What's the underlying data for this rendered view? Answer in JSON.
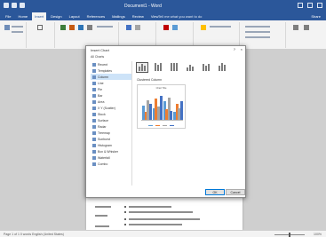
{
  "window": {
    "title": "Document1 - Word"
  },
  "tabs": [
    {
      "label": "File"
    },
    {
      "label": "Home"
    },
    {
      "label": "Insert"
    },
    {
      "label": "Design"
    },
    {
      "label": "Layout"
    },
    {
      "label": "References"
    },
    {
      "label": "Mailings"
    },
    {
      "label": "Review"
    },
    {
      "label": "View"
    }
  ],
  "tell_me": "Tell me what you want to do",
  "share": "Share",
  "dialog": {
    "title": "Insert Chart",
    "help": "?",
    "close": "×",
    "all_charts_label": "All Charts",
    "types": [
      {
        "label": "Recent"
      },
      {
        "label": "Templates"
      },
      {
        "label": "Column"
      },
      {
        "label": "Line"
      },
      {
        "label": "Pie"
      },
      {
        "label": "Bar"
      },
      {
        "label": "Area"
      },
      {
        "label": "X Y (Scatter)"
      },
      {
        "label": "Stock"
      },
      {
        "label": "Surface"
      },
      {
        "label": "Radar"
      },
      {
        "label": "Treemap"
      },
      {
        "label": "Sunburst"
      },
      {
        "label": "Histogram"
      },
      {
        "label": "Box & Whisker"
      },
      {
        "label": "Waterfall"
      },
      {
        "label": "Combo"
      }
    ],
    "selected_type": "Column",
    "preview_label": "Clustered Column",
    "preview_title": "Chart Title",
    "ok": "OK",
    "cancel": "Cancel"
  },
  "preview_colors": [
    "#5b9bd5",
    "#ed7d31",
    "#a5a5a5",
    "#4472c4"
  ],
  "preview_values": [
    [
      0.55,
      0.3,
      0.75,
      0.6
    ],
    [
      0.45,
      0.8,
      0.5,
      0.9
    ],
    [
      0.7,
      0.4,
      0.85,
      0.35
    ],
    [
      0.3,
      0.6,
      0.45,
      0.7
    ]
  ],
  "status": {
    "left": "Page 1 of 1    0 words    English (United States)",
    "zoom": "100%"
  }
}
